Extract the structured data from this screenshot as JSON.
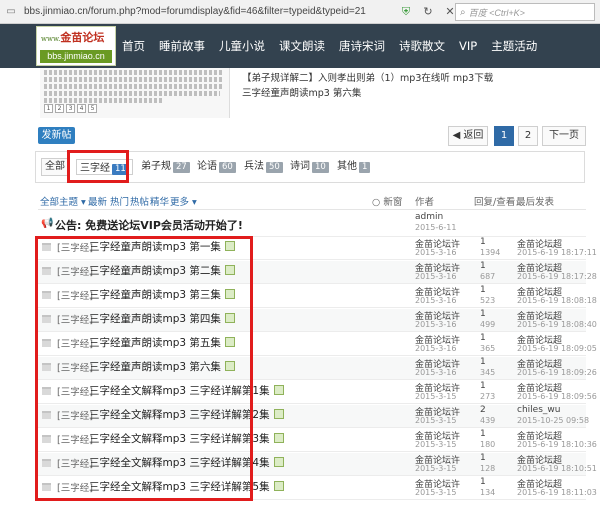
{
  "browser": {
    "url": "bbs.jinmiao.cn/forum.php?mod=forumdisplay&fid=46&filter=typeid&typeid=21",
    "search_placeholder": "百度 <Ctrl+K>"
  },
  "logo": {
    "top_text": "金苗论坛",
    "top_small": "www.",
    "domain": "bbs.jinmiao.cn"
  },
  "nav": [
    "首页",
    "睡前故事",
    "儿童小说",
    "课文朗读",
    "唐诗宋词",
    "诗歌散文",
    "VIP",
    "主题活动"
  ],
  "preview": {
    "pages": [
      "1",
      "2",
      "3",
      "4",
      "5"
    ],
    "links": [
      "【弟子规详解二】入则孝出则弟（1）mp3在线听 mp3下载",
      "三字经童声朗读mp3 第六集"
    ]
  },
  "actions": {
    "post": "发新帖",
    "prev": "◀ 返回",
    "page1": "1",
    "page2": "2",
    "next": "下一页"
  },
  "filters": [
    {
      "label": "全部",
      "count": ""
    },
    {
      "label": "三字经",
      "count": "11"
    },
    {
      "label": "弟子规",
      "count": "27"
    },
    {
      "label": "论语",
      "count": "60"
    },
    {
      "label": "兵法",
      "count": "50"
    },
    {
      "label": "诗词",
      "count": "10"
    },
    {
      "label": "其他",
      "count": "1"
    }
  ],
  "list_header": {
    "all_themes": "全部主题 ▾",
    "latest": "最新",
    "hot": "热门",
    "hot_post": "热帖",
    "digest": "精华",
    "more": "更多 ▾",
    "new_window": "新窗",
    "author": "作者",
    "reply_view": "回复/查看",
    "last_post": "最后发表"
  },
  "announcement": {
    "text": "公告: 免费送论坛VIP会员活动开始了!",
    "author": "admin",
    "date": "2015-6-11"
  },
  "threads": [
    {
      "tag": "[三字经]",
      "title": "三字经童声朗读mp3 第一集",
      "author": "金苗论坛许",
      "adate": "2015-3-16",
      "replies": "1",
      "views": "1394",
      "last_user": "金苗论坛超",
      "last_date": "2015-6-19 18:17:11"
    },
    {
      "tag": "[三字经]",
      "title": "三字经童声朗读mp3 第二集",
      "author": "金苗论坛许",
      "adate": "2015-3-16",
      "replies": "1",
      "views": "687",
      "last_user": "金苗论坛超",
      "last_date": "2015-6-19 18:17:28"
    },
    {
      "tag": "[三字经]",
      "title": "三字经童声朗读mp3 第三集",
      "author": "金苗论坛许",
      "adate": "2015-3-16",
      "replies": "1",
      "views": "523",
      "last_user": "金苗论坛超",
      "last_date": "2015-6-19 18:08:18"
    },
    {
      "tag": "[三字经]",
      "title": "三字经童声朗读mp3 第四集",
      "author": "金苗论坛许",
      "adate": "2015-3-16",
      "replies": "1",
      "views": "499",
      "last_user": "金苗论坛超",
      "last_date": "2015-6-19 18:08:40"
    },
    {
      "tag": "[三字经]",
      "title": "三字经童声朗读mp3 第五集",
      "author": "金苗论坛许",
      "adate": "2015-3-16",
      "replies": "1",
      "views": "365",
      "last_user": "金苗论坛超",
      "last_date": "2015-6-19 18:09:05"
    },
    {
      "tag": "[三字经]",
      "title": "三字经童声朗读mp3 第六集",
      "author": "金苗论坛许",
      "adate": "2015-3-16",
      "replies": "1",
      "views": "345",
      "last_user": "金苗论坛超",
      "last_date": "2015-6-19 18:09:26"
    },
    {
      "tag": "[三字经]",
      "title": "三字经全文解释mp3 三字经详解第1集",
      "author": "金苗论坛许",
      "adate": "2015-3-15",
      "replies": "1",
      "views": "273",
      "last_user": "金苗论坛超",
      "last_date": "2015-6-19 18:09:56"
    },
    {
      "tag": "[三字经]",
      "title": "三字经全文解释mp3 三字经详解第2集",
      "author": "金苗论坛许",
      "adate": "2015-3-15",
      "replies": "2",
      "views": "439",
      "last_user": "chiles_wu",
      "last_date": "2015-10-25 09:58"
    },
    {
      "tag": "[三字经]",
      "title": "三字经全文解释mp3 三字经详解第3集",
      "author": "金苗论坛许",
      "adate": "2015-3-15",
      "replies": "1",
      "views": "180",
      "last_user": "金苗论坛超",
      "last_date": "2015-6-19 18:10:36"
    },
    {
      "tag": "[三字经]",
      "title": "三字经全文解释mp3 三字经详解第4集",
      "author": "金苗论坛许",
      "adate": "2015-3-15",
      "replies": "1",
      "views": "128",
      "last_user": "金苗论坛超",
      "last_date": "2015-6-19 18:10:51"
    },
    {
      "tag": "[三字经]",
      "title": "三字经全文解释mp3 三字经详解第5集",
      "author": "金苗论坛许",
      "adate": "2015-3-15",
      "replies": "1",
      "views": "134",
      "last_user": "金苗论坛超",
      "last_date": "2015-6-19 18:11:03"
    }
  ]
}
